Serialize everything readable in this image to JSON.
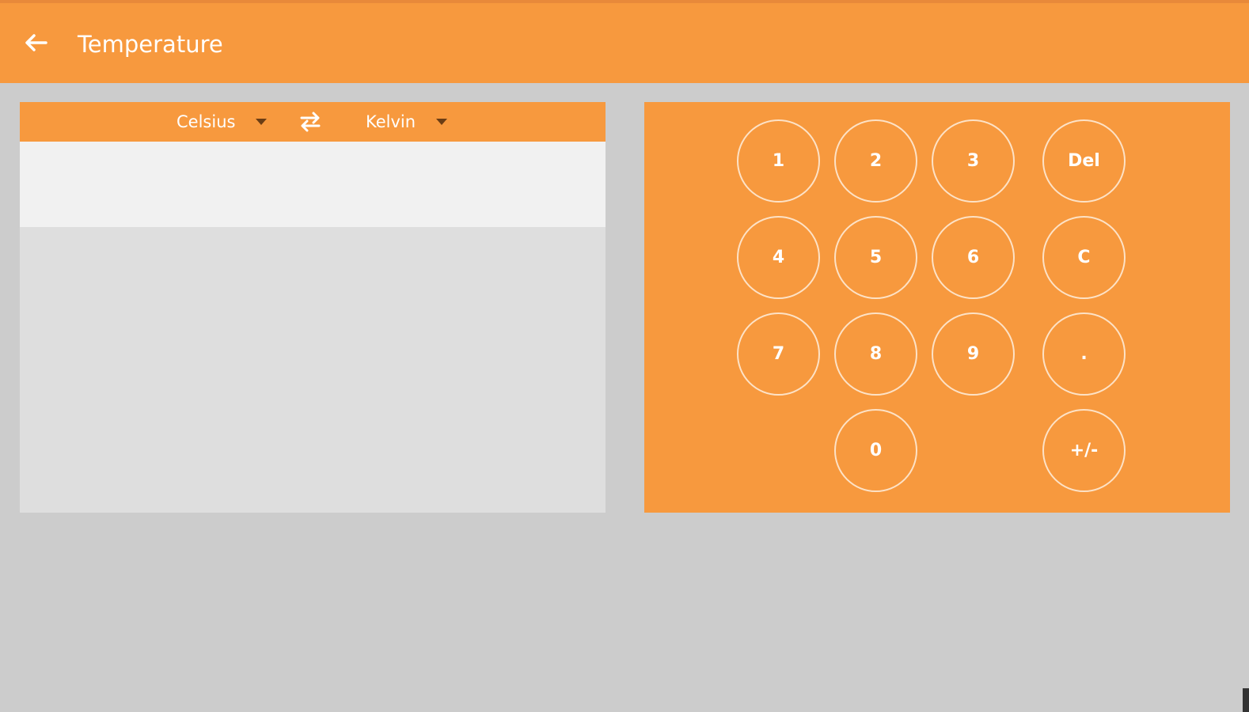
{
  "app_bar": {
    "title": "Temperature",
    "back_icon": "arrow-left-icon",
    "color": "#f7993e"
  },
  "converter": {
    "from_unit": "Celsius",
    "to_unit": "Kelvin",
    "swap_icon": "swap-arrows-icon",
    "input_value": "",
    "result_value": ""
  },
  "keypad": {
    "keys": {
      "k1": "1",
      "k2": "2",
      "k3": "3",
      "del": "Del",
      "k4": "4",
      "k5": "5",
      "k6": "6",
      "clear": "C",
      "k7": "7",
      "k8": "8",
      "k9": "9",
      "dot": ".",
      "k0": "0",
      "sign": "+/-"
    }
  },
  "colors": {
    "accent": "#f7993e",
    "background": "#cccccc",
    "panel": "#dedede",
    "input_bg": "#f1f1f1",
    "key_border": "#fde2c6"
  }
}
